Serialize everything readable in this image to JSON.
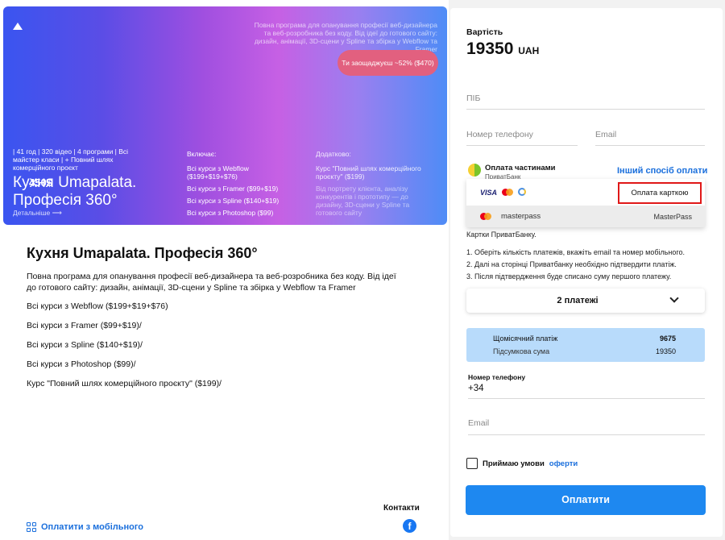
{
  "banner": {
    "top_text": "Повна програма для опанування професії веб-дизайнера та веб-розробника без коду. Від ідеї до готового сайту: дизайн, анімації, 3D-сцени у Spline та збірка у Webflow та Framer",
    "save_badge": "Ти заощаджуєш ~52% ($470)",
    "price": "450$",
    "meta": "| 41 год | 320 відео | 4 програми | Всі майстер класи | + Повний шлях комерційного проєкт",
    "title": "Кухня Umapalata. Професія 360°",
    "more_label": "Детальніше",
    "includes_title": "Включає:",
    "includes": [
      "Всі курси з Webflow ($199+$19+$76)",
      "Всі курси з Framer ($99+$19)",
      "Всі курси з Spline ($140+$19)",
      "Всі курси з Photoshop ($99)"
    ],
    "extra_title": "Додатково:",
    "extra": "Курс \"Повний шлях комерційного проєкту\" ($199)",
    "extra_desc": "Від портрету клієнта, аналізу конкурентів і прототипу — до дизайну, 3D-сцени у Spline та готового сайту"
  },
  "course": {
    "title": "Кухня Umapalata. Професія 360°",
    "description": "Повна програма для опанування професії веб-дизайнера та веб-розробника без коду. Від ідеї до готового сайту: дизайн, анімації, 3D-сцени у Spline та збірка у Webflow та Framer",
    "lines": [
      "Всі курси з Webflow ($199+$19+$76)",
      "Всі курси з Framer ($99+$19)/",
      "Всі курси з Spline ($140+$19)/",
      "Всі курси з Photoshop ($99)/",
      "Курс \"Повний шлях комерційного проєкту\" ($199)/"
    ]
  },
  "footer": {
    "contacts": "Контакти",
    "mobile_pay": "Оплатити з мобільного",
    "facebook_glyph": "f"
  },
  "checkout": {
    "price_label": "Вартість",
    "price_value": "19350",
    "currency": "UAH",
    "name_placeholder": "ПІБ",
    "phone_placeholder": "Номер телефону",
    "email_placeholder": "Email",
    "partpay_label": "Оплата частинами",
    "partpay_sub": "ПриватБанк",
    "other_method": "Інший спосіб оплати",
    "visa_label": "VISA",
    "card_pay": "Оплата карткою",
    "masterpass_logo_text": "masterpass",
    "masterpass": "MasterPass",
    "hidden_text": "Картки ПриватБанку.",
    "instructions": [
      "1. Оберіть кількість платежів, вкажіть email та номер мобільного.",
      "2. Далі на сторінці Приватбанку необхідно підтвердити платіж.",
      "3. Після підтвердження буде списано суму першого платежу."
    ],
    "installments": "2 платежі",
    "monthly_label": "Щомісячний платіж",
    "monthly_value": "9675",
    "total_label": "Підсумкова сума",
    "total_value": "19350",
    "phone_label": "Номер телефону",
    "phone_value": "+34",
    "email2_placeholder": "Email",
    "agree_text": "Приймаю умови",
    "agree_link": "оферти",
    "pay_button": "Оплатити"
  },
  "colors": {
    "accent": "#1e88f0",
    "link": "#1a6fdc",
    "summary_bg": "#b8dbfb",
    "highlight": "#e01818"
  }
}
